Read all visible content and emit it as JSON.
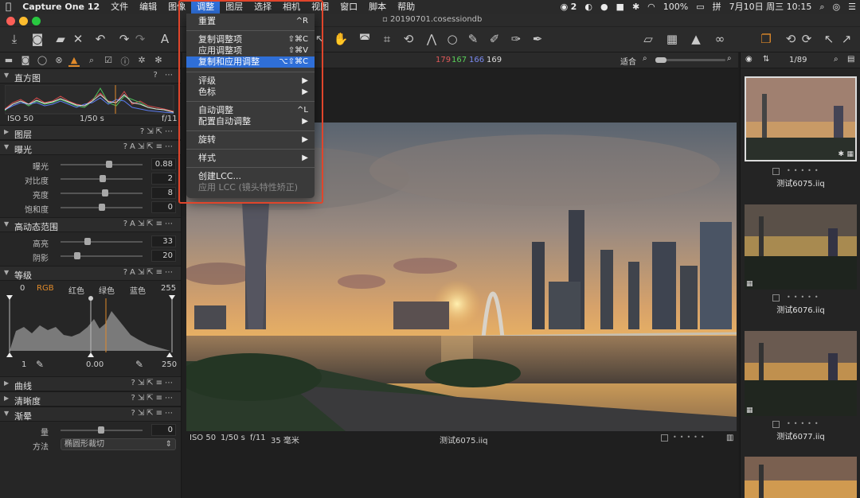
{
  "menubar": {
    "apple": "",
    "app_name": "Capture One 12",
    "menus": [
      "文件",
      "编辑",
      "图像",
      "调整",
      "图层",
      "选择",
      "相机",
      "视图",
      "窗口",
      "脚本",
      "帮助"
    ],
    "wechat_count": "2",
    "battery": "100%",
    "input_method": "拼",
    "datetime": "7月10日 周三  10:15"
  },
  "window": {
    "title": "20190701.cosessiondb"
  },
  "adjust_menu": {
    "items": [
      {
        "label": "重置",
        "shortcut": "^R"
      },
      {
        "label": "复制调整项",
        "shortcut": "⇧⌘C"
      },
      {
        "label": "应用调整项",
        "shortcut": "⇧⌘V"
      },
      {
        "label": "复制和应用调整",
        "shortcut": "⌥⇧⌘C"
      },
      {
        "label": "评级",
        "shortcut": "▶"
      },
      {
        "label": "色标",
        "shortcut": "▶"
      },
      {
        "label": "自动调整",
        "shortcut": "^L"
      },
      {
        "label": "配置自动调整",
        "shortcut": "▶"
      },
      {
        "label": "旋转",
        "shortcut": "▶"
      },
      {
        "label": "样式",
        "shortcut": "▶"
      },
      {
        "label": "创建LCC...",
        "shortcut": ""
      },
      {
        "label": "应用 LCC (镜头特性矫正)",
        "shortcut": ""
      }
    ]
  },
  "histogram": {
    "title": "直方图",
    "iso": "ISO 50",
    "shutter": "1/50 s",
    "aperture": "f/11"
  },
  "layers": {
    "title": "图层"
  },
  "exposure": {
    "title": "曝光",
    "sliders": [
      {
        "label": "曝光",
        "value": "0.88",
        "level": 0.59
      },
      {
        "label": "对比度",
        "value": "2",
        "level": 0.51
      },
      {
        "label": "亮度",
        "value": "8",
        "level": 0.54
      },
      {
        "label": "饱和度",
        "value": "0",
        "level": 0.5
      }
    ]
  },
  "hdr": {
    "title": "高动态范围",
    "sliders": [
      {
        "label": "高亮",
        "value": "33",
        "level": 0.33
      },
      {
        "label": "阴影",
        "value": "20",
        "level": 0.2
      }
    ]
  },
  "levels": {
    "title": "等级",
    "input_low": "0",
    "channels": [
      "RGB",
      "红色",
      "绿色",
      "蓝色"
    ],
    "input_high": "255",
    "output_low": "1",
    "midpoint": "0.00",
    "output_high": "250"
  },
  "curves": {
    "title": "曲线"
  },
  "clarity": {
    "title": "清晰度"
  },
  "vignette": {
    "title": "渐晕",
    "amount_label": "量",
    "amount_value": "0",
    "method_label": "方法",
    "method_value": "椭圆形裁切"
  },
  "viewer": {
    "rgb_r": "179",
    "rgb_g": "167",
    "rgb_b": "166",
    "rgb_l": "169",
    "fit_label": "适合",
    "iso": "ISO 50",
    "shutter": "1/50 s",
    "aperture": "f/11",
    "focal": "35 毫米",
    "filename": "测试6075.iiq"
  },
  "browser": {
    "count": "1/89",
    "thumbnails": [
      "测试6075.iiq",
      "测试6076.iiq",
      "测试6077.iiq"
    ]
  },
  "colors": {
    "menu_highlight": "#2f6fd8",
    "annotation_box": "#e0452b",
    "tool_active": "#e08a2a"
  }
}
